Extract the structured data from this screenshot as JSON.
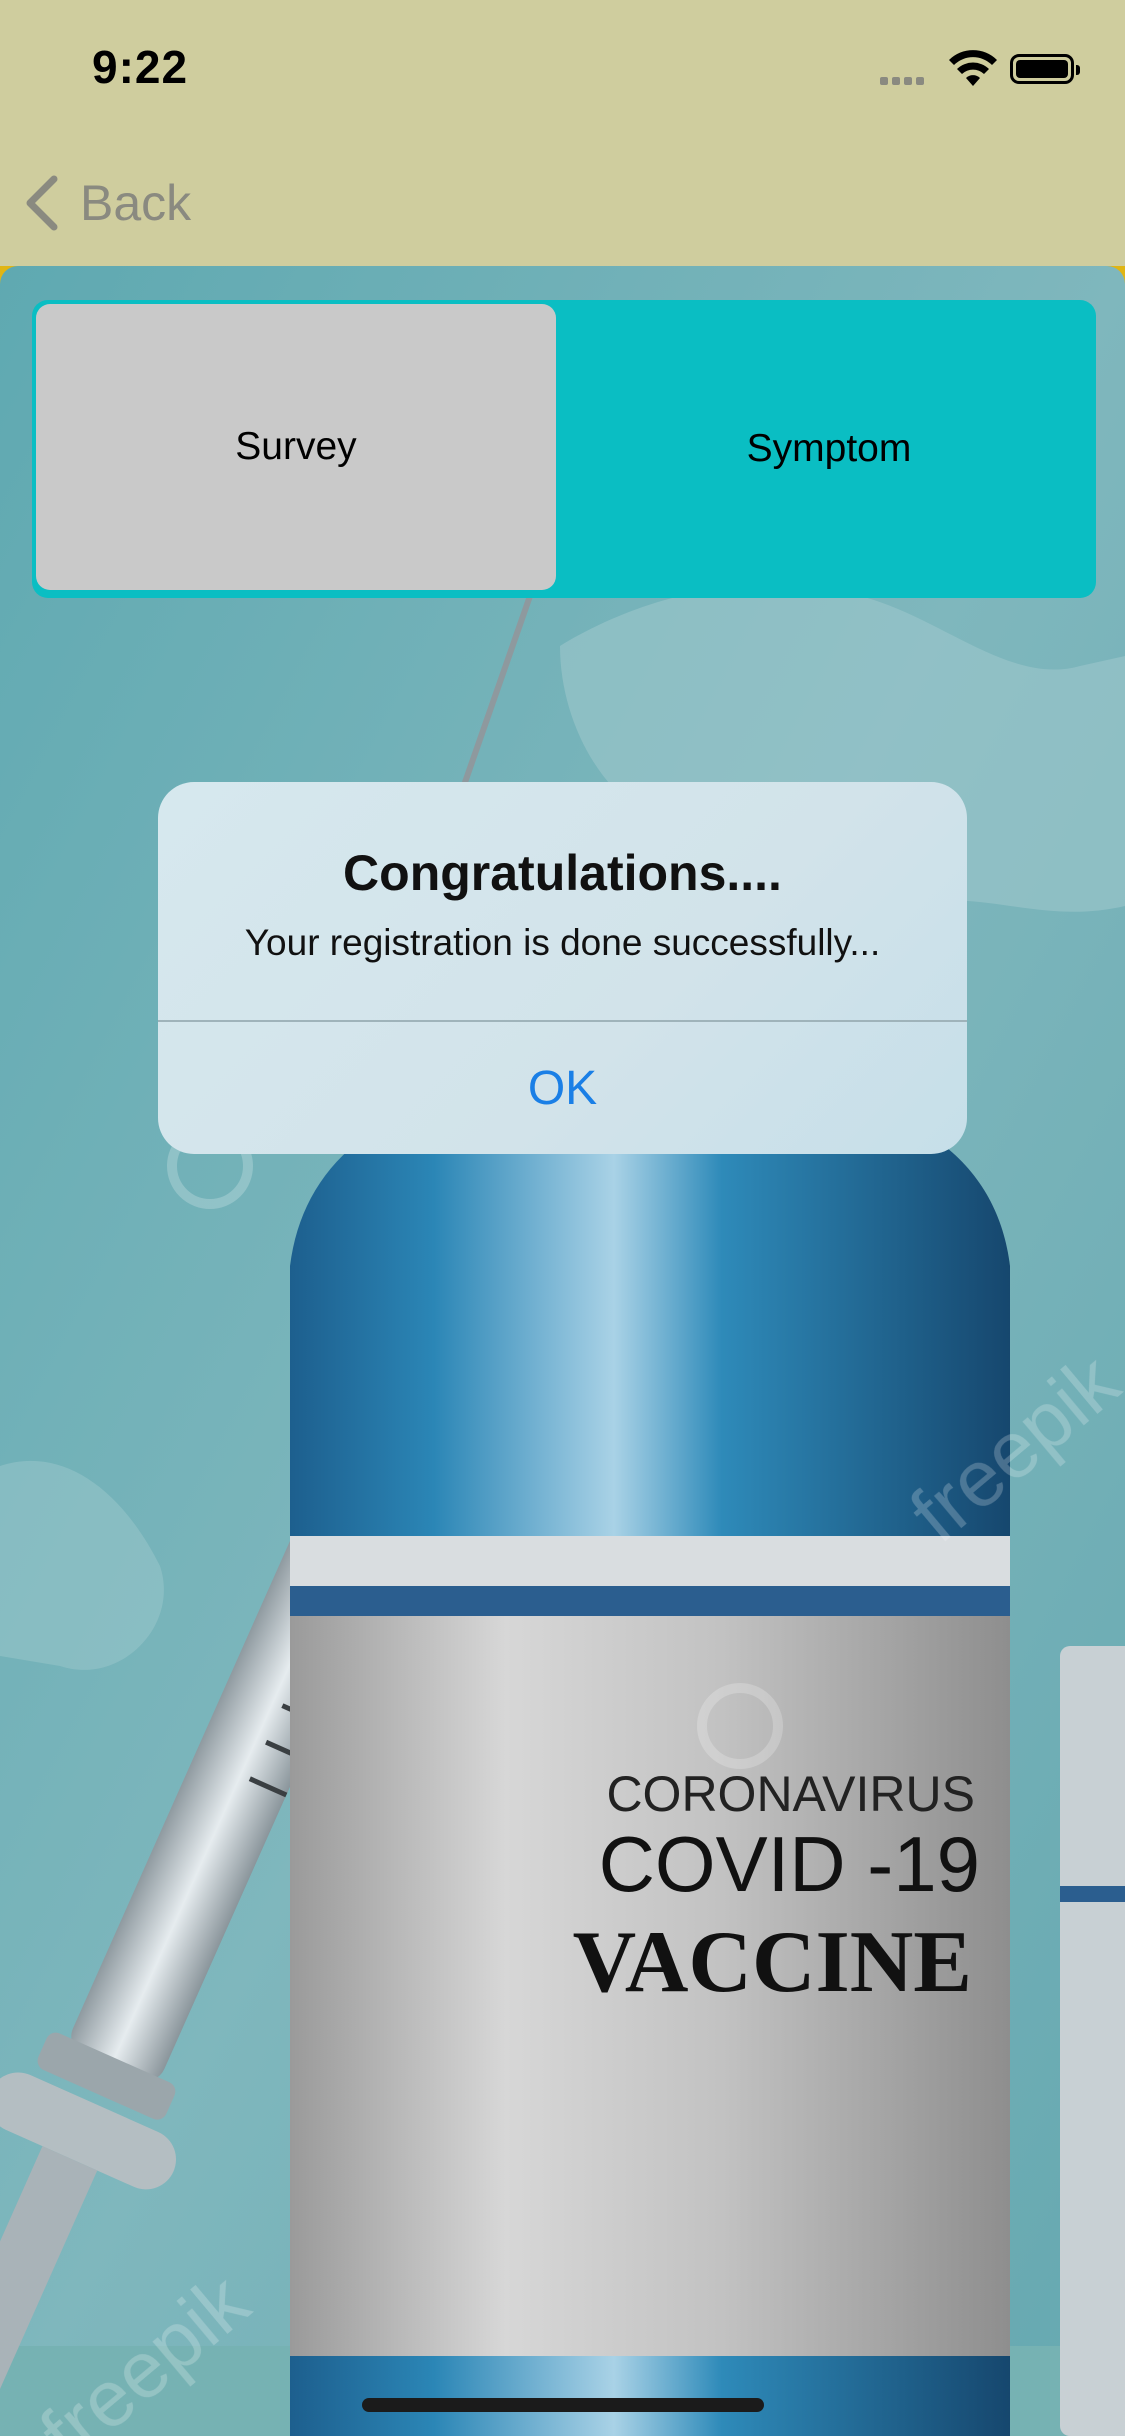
{
  "status_bar": {
    "time": "9:22",
    "icons": [
      "signal-icon",
      "wifi-icon",
      "battery-icon"
    ]
  },
  "nav": {
    "back_label": "Back",
    "back_icon": "chevron-left-icon"
  },
  "tabs": [
    {
      "label": "Survey",
      "selected": true
    },
    {
      "label": "Symptom",
      "selected": false
    }
  ],
  "background_image": {
    "watermark": "freepik",
    "label_line1": "CORONAVIRUS",
    "label_line2": "COVID -19",
    "label_line3": "VACCINE"
  },
  "alert": {
    "title": "Congratulations....",
    "message": "Your registration is done successfully...",
    "ok_label": "OK"
  },
  "colors": {
    "header_bg": "#cfcd9e",
    "segment_bg": "#0abec3",
    "segment_selected_bg": "#c9c9c9",
    "alert_button": "#1a7fe6"
  }
}
